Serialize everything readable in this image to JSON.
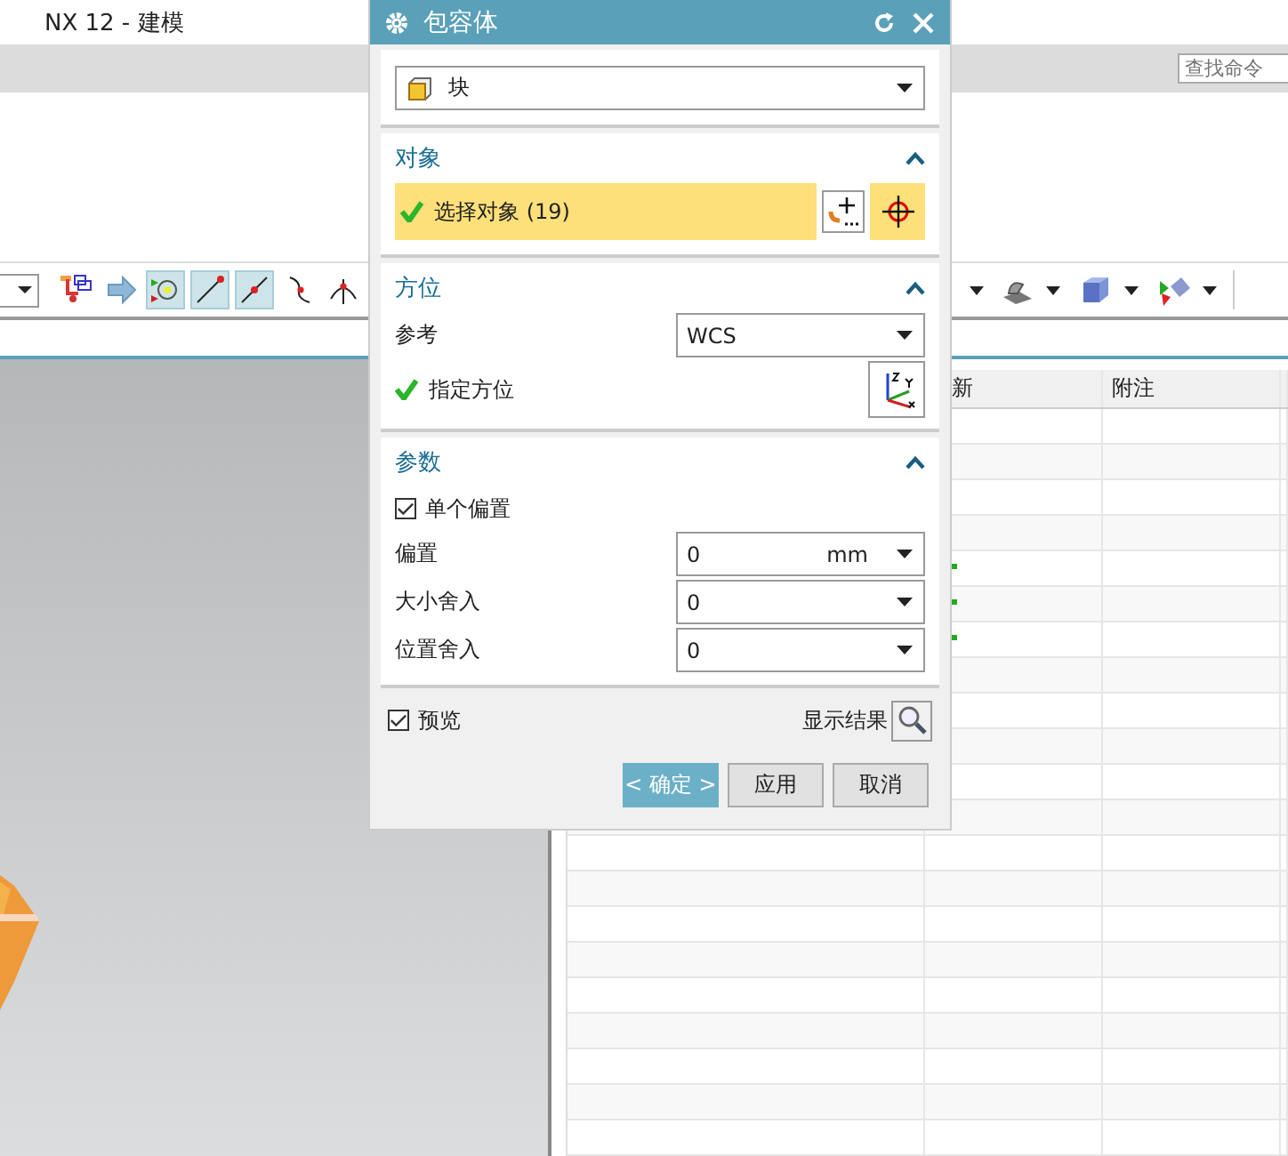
{
  "app": {
    "title": "NX 12 - 建模"
  },
  "command_search": {
    "placeholder": "查找命令"
  },
  "toolbar": {
    "left_items": [
      {
        "selected": false
      },
      {
        "selected": false
      },
      {
        "selected": true
      },
      {
        "selected": true
      },
      {
        "selected": true
      },
      {
        "selected": false
      },
      {
        "selected": false
      }
    ],
    "right_items": [
      {
        "selected": false
      },
      {
        "selected": false
      },
      {
        "selected": false
      }
    ]
  },
  "table": {
    "columns": [
      "新",
      "附注"
    ],
    "rows": [
      {
        "marked": false
      },
      {
        "marked": false
      },
      {
        "marked": false
      },
      {
        "marked": false
      },
      {
        "marked": true
      },
      {
        "marked": true
      },
      {
        "marked": true
      },
      {
        "marked": false
      },
      {
        "marked": false
      },
      {
        "marked": false
      },
      {
        "marked": false
      },
      {
        "marked": false
      },
      {
        "marked": false
      },
      {
        "marked": false
      },
      {
        "marked": false
      },
      {
        "marked": false
      },
      {
        "marked": false
      },
      {
        "marked": false
      },
      {
        "marked": false
      },
      {
        "marked": false
      },
      {
        "marked": false
      }
    ]
  },
  "dialog": {
    "title": "包容体",
    "type_value": "块",
    "sections": [
      {
        "kind": "selection",
        "title": "对象",
        "expanded": true,
        "label": "选择对象 (19)",
        "done": true
      },
      {
        "kind": "orientation",
        "title": "方位",
        "expanded": true,
        "reference_label": "参考",
        "reference_value": "WCS",
        "specify_label": "指定方位",
        "done": true
      },
      {
        "kind": "parameters",
        "title": "参数",
        "expanded": true,
        "single_offset": {
          "label": "单个偏置",
          "checked": true
        },
        "fields": [
          {
            "label": "偏置",
            "value": "0",
            "unit": "mm"
          },
          {
            "label": "大小舍入",
            "value": "0"
          },
          {
            "label": "位置舍入",
            "value": "0"
          }
        ]
      }
    ],
    "preview": {
      "label": "预览",
      "checked": true
    },
    "show_result": "显示结果",
    "buttons": [
      {
        "label": "< 确定 >",
        "kind": "primary"
      },
      {
        "label": "应用",
        "kind": "normal"
      },
      {
        "label": "取消",
        "kind": "normal"
      }
    ]
  }
}
